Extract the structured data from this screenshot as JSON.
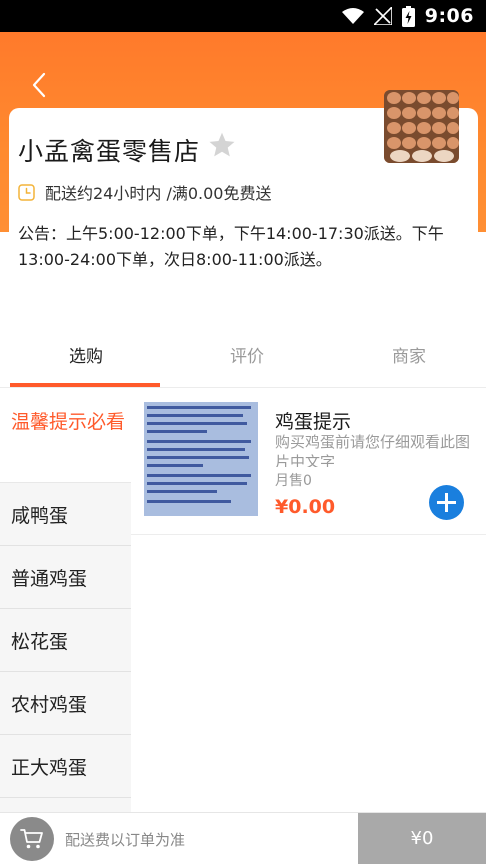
{
  "status_bar": {
    "time": "9:06",
    "icons": [
      "wifi-icon",
      "no-signal-icon",
      "battery-charging-icon"
    ]
  },
  "header": {
    "back_icon": "chevron-left-icon",
    "accent_color": "#ff7a2b"
  },
  "shop": {
    "name": "小孟禽蛋零售店",
    "favorite_icon": "star-icon",
    "delivery_info": "配送约24小时内 /满0.00免费送",
    "notice": "公告：上午5:00-12:00下单，下午14:00-17:30派送。下午13:00-24:00下单，次日8:00-11:00派送。"
  },
  "tabs": [
    {
      "label": "选购",
      "active": true
    },
    {
      "label": "评价",
      "active": false
    },
    {
      "label": "商家",
      "active": false
    }
  ],
  "categories": [
    {
      "label": "温馨提示必看",
      "active": true
    },
    {
      "label": "咸鸭蛋",
      "active": false
    },
    {
      "label": "普通鸡蛋",
      "active": false
    },
    {
      "label": "松花蛋",
      "active": false
    },
    {
      "label": "农村鸡蛋",
      "active": false
    },
    {
      "label": "正大鸡蛋",
      "active": false
    }
  ],
  "products": [
    {
      "title": "鸡蛋提示",
      "description": "购买鸡蛋前请您仔细观看此图片中文字",
      "sold": "月售0",
      "price": "¥0.00"
    }
  ],
  "bottom_bar": {
    "cart_icon": "cart-icon",
    "fee_note": "配送费以订单为准",
    "total": "¥0"
  }
}
